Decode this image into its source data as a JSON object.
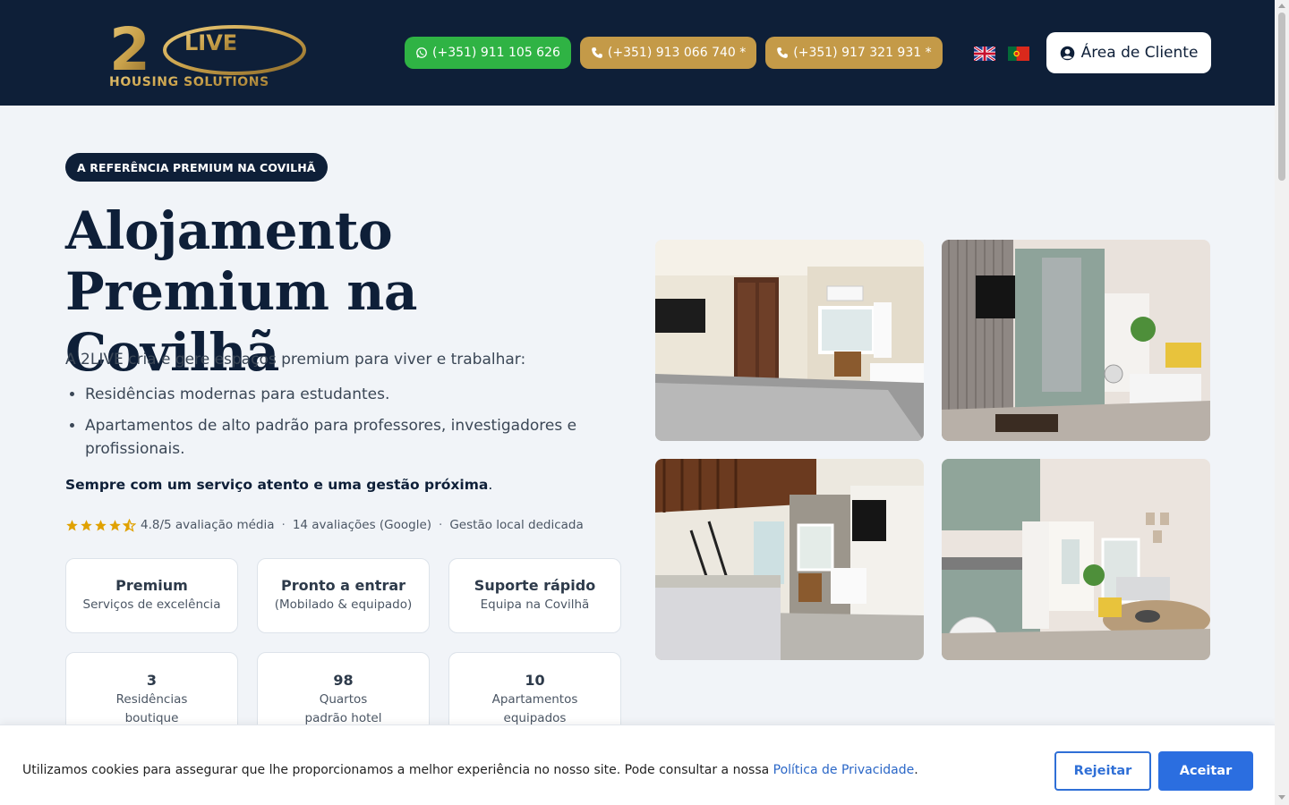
{
  "header": {
    "logo": {
      "brand": "2LIVE",
      "subtitle": "HOUSING SOLUTIONS",
      "colors": {
        "gold": "#c9a14a",
        "navy": "#0e1f38"
      }
    },
    "phones": [
      {
        "label": "(+351) 911 105 626",
        "icon": "whatsapp-icon",
        "color": "#2fb344"
      },
      {
        "label": "(+351) 913 066 740 *",
        "icon": "phone-icon",
        "color": "#c49a48"
      },
      {
        "label": "(+351) 917 321 931 *",
        "icon": "phone-icon",
        "color": "#c49a48"
      }
    ],
    "languages": [
      "uk-flag-icon",
      "portugal-flag-icon"
    ],
    "client_area_label": "Área de Cliente",
    "client_area_icon": "user-circle-icon"
  },
  "hero": {
    "badge": "A REFERÊNCIA PREMIUM NA COVILHÃ",
    "title_line1": "Alojamento",
    "title_line2": "Premium na Covilhã",
    "intro": "A 2LIVE cria e gere espaços premium para viver e trabalhar:",
    "bullets": [
      "Residências modernas para estudantes.",
      "Apartamentos de alto padrão para professores, investigadores e profissionais."
    ],
    "tagline_bold": "Sempre com um serviço atento e uma gestão próxima",
    "tagline_end": ".",
    "rating": {
      "stars": 4.5,
      "average_text": "4.8/5 avaliação média",
      "reviews_text": "14 avaliações (Google)",
      "extra_text": "Gestão local dedicada",
      "separator": "·",
      "star_color": "#e0a100"
    },
    "features": [
      {
        "title": "Premium",
        "subtitle": "Serviços de excelência"
      },
      {
        "title": "Pronto a entrar",
        "subtitle": "(Mobilado & equipado)"
      },
      {
        "title": "Suporte rápido",
        "subtitle": "Equipa na Covilhã"
      }
    ],
    "stats": [
      {
        "value": "3",
        "line1": "Residências",
        "line2": "boutique"
      },
      {
        "value": "98",
        "line1": "Quartos",
        "line2": "padrão hotel"
      },
      {
        "value": "10",
        "line1": "Apartamentos",
        "line2": "equipados"
      }
    ]
  },
  "gallery": {
    "photos": [
      "bedroom-with-wardrobe-photo",
      "living-kitchen-photo",
      "loft-bedroom-photo",
      "kitchen-dining-photo"
    ]
  },
  "cookie": {
    "text": "Utilizamos cookies para assegurar que lhe proporcionamos a melhor experiência no nosso site. Pode consultar a nossa ",
    "link_text": "Política de Privacidade",
    "text_end": ".",
    "reject_label": "Rejeitar",
    "accept_label": "Aceitar",
    "accent_color": "#2b6ee0"
  }
}
